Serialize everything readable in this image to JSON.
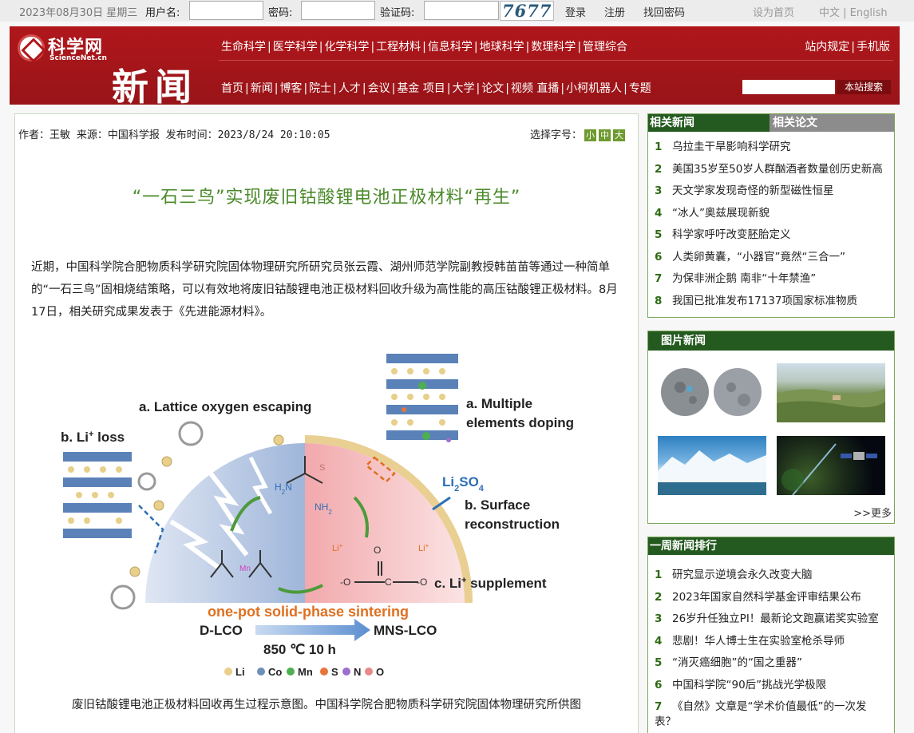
{
  "topbar": {
    "date": "2023年08月30日 星期三",
    "username_label": "用户名:",
    "password_label": "密码:",
    "captcha_label": "验证码:",
    "captcha_text": "7677",
    "login": "登录",
    "register": "注册",
    "forgot": "找回密码",
    "set_home": "设为首页",
    "lang": "中文 | English"
  },
  "header": {
    "logo_cn": "科学网",
    "logo_en": "ScienceNet.cn",
    "section": "新闻",
    "nav1": [
      "生命科学",
      "医学科学",
      "化学科学",
      "工程材料",
      "信息科学",
      "地球科学",
      "数理科学",
      "管理综合"
    ],
    "nav2": [
      "首页",
      "新闻",
      "博客",
      "院士",
      "人才",
      "会议",
      "基金 项目",
      "大学",
      "论文",
      "视频 直播",
      "小柯机器人",
      "专题"
    ],
    "right_links": [
      "站内规定",
      "手机版"
    ],
    "search_button": "本站搜索",
    "search_placeholder": ""
  },
  "article": {
    "meta": "作者：王敏 来源：中国科学报 发布时间：2023/8/24 20:10:05",
    "font_select_label": "选择字号：",
    "font_sizes": [
      "小",
      "中",
      "大"
    ],
    "title": "“一石三鸟”实现废旧钴酸锂电池正极材料“再生”",
    "body": "近期，中国科学院合肥物质科学研究院固体物理研究所研究员张云霞、湖州师范学院副教授韩苗苗等通过一种简单的“一石三鸟”固相烧结策略，可以有效地将废旧钴酸锂电池正极材料回收升级为高性能的高压钴酸锂正极材料。8月17日，相关研究成果发表于《先进能源材料》。",
    "caption": "废旧钴酸锂电池正极材料回收再生过程示意图。中国科学院合肥物质科学研究院固体物理研究所供图",
    "figure": {
      "a_oxygen": "a. Lattice oxygen escaping",
      "b_loss": "b. Li",
      "b_loss_sup": "+",
      "b_loss_tail": " loss",
      "a_doping": [
        "a. Multiple",
        "elements doping"
      ],
      "li2so4": "Li",
      "li2so4_sub1": "2",
      "li2so4_mid": "SO",
      "li2so4_sub2": "4",
      "b_surface": [
        "b. Surface",
        "reconstruction"
      ],
      "c_supplement": "c. Li",
      "c_supplement_sup": "+",
      "c_supplement_tail": " supplement",
      "sintering": "one-pot solid-phase sintering",
      "d_lco": "D-LCO",
      "mns_lco": "MNS-LCO",
      "condition": "850 ℃ 10 h",
      "legend": [
        "Li",
        "Co",
        "Mn",
        "S",
        "N",
        "O"
      ],
      "legend_colors": [
        "#e8cf8a",
        "#6e8fb8",
        "#4caf50",
        "#e8743b",
        "#9b6fcf",
        "#e88888"
      ],
      "mn_label": "Mn",
      "li_plus": "Li",
      "s_atom": "S",
      "h2n": "H",
      "h2n_sub": "2",
      "h2n_n": "N",
      "nh2": "NH",
      "nh2_sub": "2",
      "carbonate_o": "O",
      "carbonate_c": "C",
      "carbonate_neg": "-O"
    }
  },
  "related": {
    "tab_news": "相关新闻",
    "tab_papers": "相关论文",
    "items": [
      "乌拉圭干旱影响科学研究",
      "美国35岁至50岁人群酗酒者数量创历史新高",
      "天文学家发现奇怪的新型磁性恒星",
      "“冰人”奥兹展现新貌",
      "科学家呼吁改变胚胎定义",
      "人类卵黄囊，“小器官”竟然“三合一”",
      "为保非洲企鹅   南非“十年禁渔”",
      "我国已批准发布17137项国家标准物质"
    ]
  },
  "pictures": {
    "title": "图片新闻",
    "more": ">>更多",
    "thumbs": [
      "moon-craters-image",
      "landscape-image",
      "glacier-image",
      "satellite-image"
    ]
  },
  "weekly": {
    "title": "一周新闻排行",
    "items": [
      "研究显示逆境会永久改变大脑",
      "2023年国家自然科学基金评审结果公布",
      "26岁升任独立PI！最新论文跑赢诺奖实验室",
      "悲剧！华人博士生在实验室枪杀导师",
      "“消灭癌细胞”的“国之重器”",
      "中国科学院“90后”挑战光学极限",
      "《自然》文章是“学术价值最低”的一次发表？"
    ]
  }
}
